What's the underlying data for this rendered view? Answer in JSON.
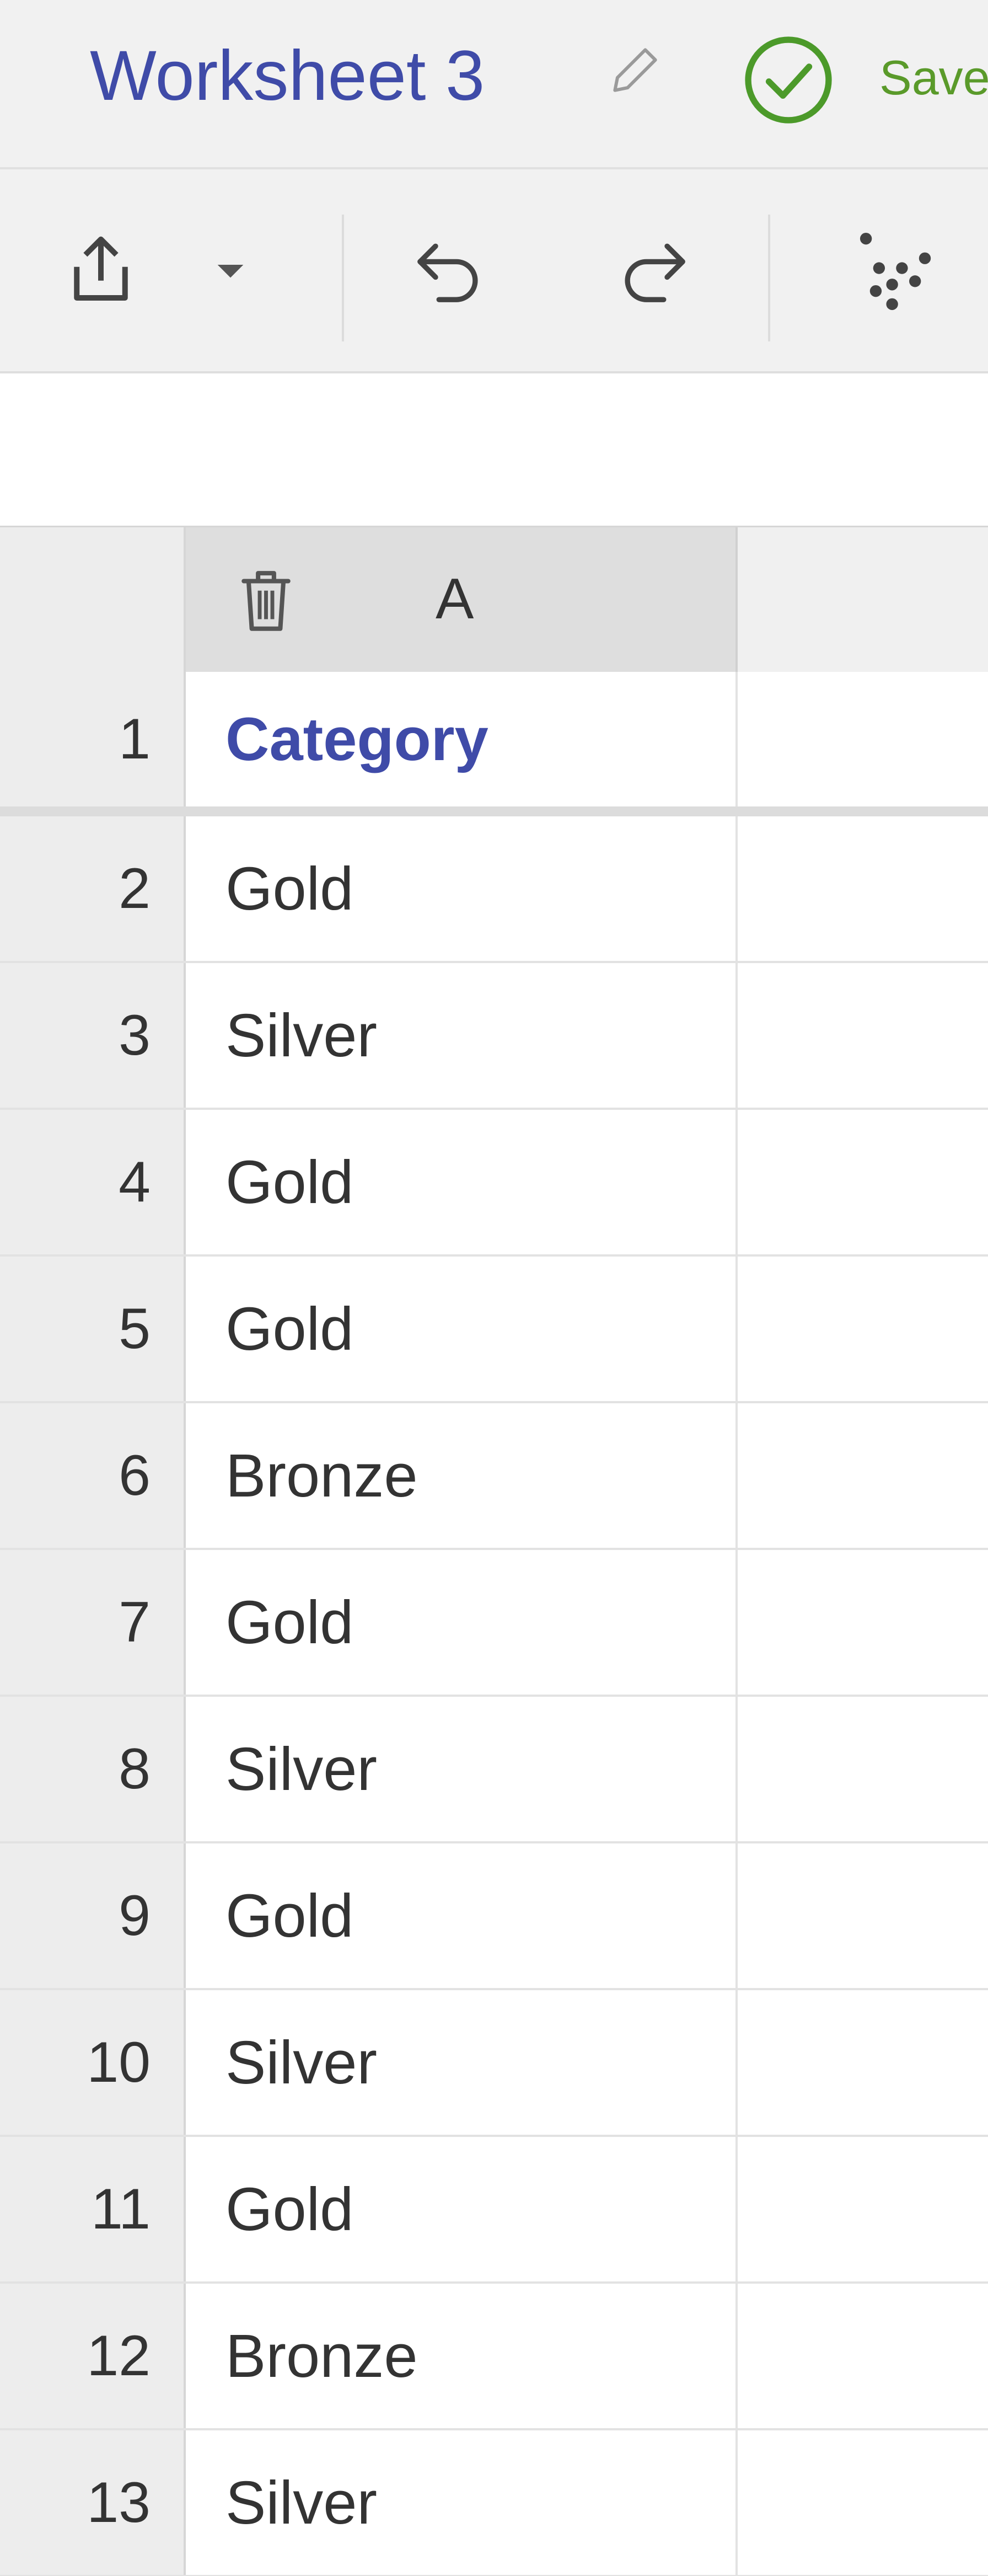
{
  "window": {
    "title": "Worksheet 3",
    "status_text": "Save"
  },
  "toolbar": {
    "icons": [
      "share-icon",
      "dropdown-caret-icon",
      "undo-icon",
      "redo-icon",
      "scatter-plot-icon"
    ]
  },
  "grid": {
    "column_a_label": "A",
    "rows": [
      {
        "num": "1",
        "a": "Category"
      },
      {
        "num": "2",
        "a": "Gold"
      },
      {
        "num": "3",
        "a": "Silver"
      },
      {
        "num": "4",
        "a": "Gold"
      },
      {
        "num": "5",
        "a": "Gold"
      },
      {
        "num": "6",
        "a": "Bronze"
      },
      {
        "num": "7",
        "a": "Gold"
      },
      {
        "num": "8",
        "a": "Silver"
      },
      {
        "num": "9",
        "a": "Gold"
      },
      {
        "num": "10",
        "a": "Silver"
      },
      {
        "num": "11",
        "a": "Gold"
      },
      {
        "num": "12",
        "a": "Bronze"
      },
      {
        "num": "13",
        "a": "Silver"
      }
    ]
  },
  "colors": {
    "title": "#3f4ba8",
    "saved": "#5a9a2a",
    "header_bg": "#f1f1f1",
    "text": "#333333"
  }
}
